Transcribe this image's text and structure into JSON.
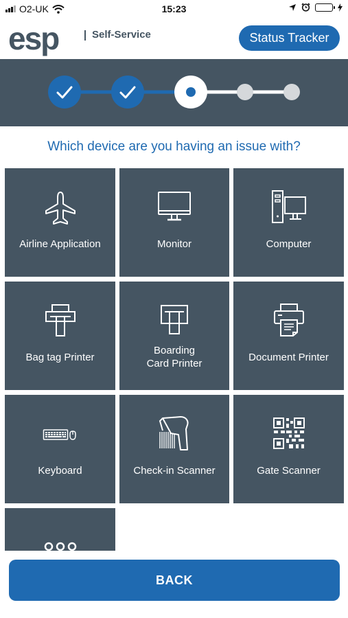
{
  "status_bar": {
    "carrier": "O2-UK",
    "time": "15:23",
    "icons": [
      "signal-icon",
      "wifi-icon",
      "location-icon",
      "alarm-icon",
      "battery-icon",
      "charging-icon"
    ]
  },
  "header": {
    "logo_text": "esp",
    "subtitle": "Self-Service",
    "status_tracker_label": "Status Tracker"
  },
  "progress": {
    "total_steps": 5,
    "completed_steps": 2,
    "current_step": 3,
    "colors": {
      "completed": "#1f6ab1",
      "current": "#ffffff",
      "pending": "#d5d8db"
    }
  },
  "question": "Which device are you having an issue with?",
  "devices": [
    {
      "label": "Airline Application",
      "icon": "airplane-icon"
    },
    {
      "label": "Monitor",
      "icon": "monitor-icon"
    },
    {
      "label": "Computer",
      "icon": "computer-icon"
    },
    {
      "label": "Bag tag Printer",
      "icon": "bag-tag-printer-icon"
    },
    {
      "label_line1": "Boarding",
      "label_line2": "Card Printer",
      "icon": "boarding-card-printer-icon"
    },
    {
      "label": "Document Printer",
      "icon": "document-printer-icon"
    },
    {
      "label": "Keyboard",
      "icon": "keyboard-icon"
    },
    {
      "label": "Check-in Scanner",
      "icon": "barcode-scanner-icon"
    },
    {
      "label": "Gate Scanner",
      "icon": "qr-code-icon"
    },
    {
      "label": "",
      "icon": "more-icon"
    }
  ],
  "back_label": "BACK",
  "colors": {
    "primary": "#1f6ab1",
    "tile": "#455562",
    "text_on_tile": "#ffffff"
  }
}
